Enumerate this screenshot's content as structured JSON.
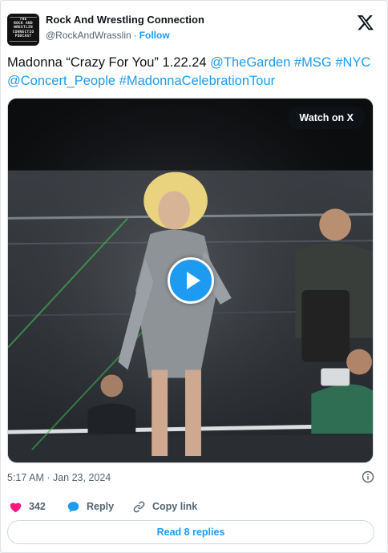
{
  "author": {
    "name": "Rock And Wrestling Connection",
    "handle": "@RockAndWrasslin",
    "separator": "·",
    "follow_label": "Follow",
    "avatar_text": [
      "THE",
      "ROCK AND",
      "WRESTLIN",
      "CONNECTIO",
      "PODCAST"
    ]
  },
  "tweet": {
    "text_plain": "Madonna “Crazy For You” 1.22.24 ",
    "links": [
      "@TheGarden",
      "#MSG",
      "#NYC",
      "@Concert_People",
      "#MadonnaCelebrationTour"
    ]
  },
  "media": {
    "watch_label": "Watch on X",
    "icon": "play-icon"
  },
  "meta": {
    "timestamp": "5:17 AM · Jan 23, 2024"
  },
  "actions": {
    "like_count": "342",
    "reply_label": "Reply",
    "copy_label": "Copy link",
    "read_replies_label": "Read 8 replies"
  },
  "colors": {
    "accent": "#1d9bf0",
    "like": "#f91880",
    "muted": "#536471",
    "text": "#0f1419"
  }
}
